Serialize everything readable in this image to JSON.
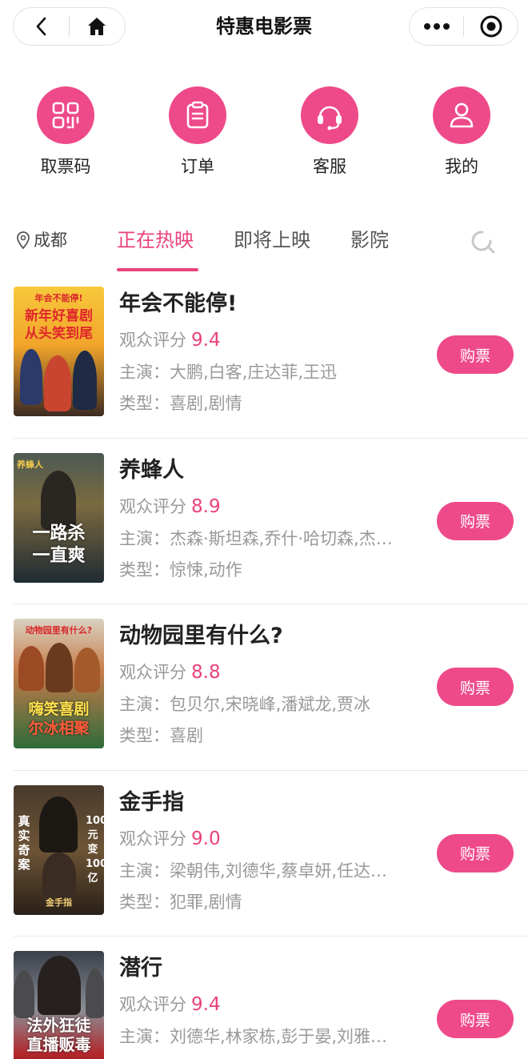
{
  "header": {
    "title": "特惠电影票"
  },
  "quick_menu": [
    {
      "label": "取票码",
      "icon": "ticket-code-icon"
    },
    {
      "label": "订单",
      "icon": "order-clipboard-icon"
    },
    {
      "label": "客服",
      "icon": "headset-icon"
    },
    {
      "label": "我的",
      "icon": "user-icon"
    }
  ],
  "tabs": {
    "city": "成都",
    "items": [
      "正在热映",
      "即将上映",
      "影院"
    ],
    "active_index": 0
  },
  "movies": [
    {
      "title": "年会不能停!",
      "rating_label": "观众评分",
      "rating": "9.4",
      "actors": "主演：大鹏,白客,庄达菲,王迅",
      "genre": "类型：喜剧,剧情",
      "buy_label": "购票",
      "poster_text": [
        "新年好喜剧",
        "从头笑到尾"
      ]
    },
    {
      "title": "养蜂人",
      "rating_label": "观众评分",
      "rating": "8.9",
      "actors": "主演：杰森·斯坦森,乔什·哈切森,杰…",
      "genre": "类型：惊悚,动作",
      "buy_label": "购票",
      "poster_text": [
        "一路杀",
        "一直爽"
      ]
    },
    {
      "title": "动物园里有什么?",
      "rating_label": "观众评分",
      "rating": "8.8",
      "actors": "主演：包贝尔,宋晓峰,潘斌龙,贾冰",
      "genre": "类型：喜剧",
      "buy_label": "购票",
      "poster_text": [
        "嗨笑喜剧",
        "尔冰相聚"
      ]
    },
    {
      "title": "金手指",
      "rating_label": "观众评分",
      "rating": "9.0",
      "actors": "主演：梁朝伟,刘德华,蔡卓妍,任达…",
      "genre": "类型：犯罪,剧情",
      "buy_label": "购票",
      "poster_text": [
        "真实奇案",
        "100元变100亿"
      ]
    },
    {
      "title": "潜行",
      "rating_label": "观众评分",
      "rating": "9.4",
      "actors": "主演：刘德华,林家栋,彭于晏,刘雅…",
      "genre": "",
      "buy_label": "购票",
      "poster_text": [
        "法外狂徒",
        "直播贩毒"
      ]
    }
  ],
  "colors": {
    "accent": "#ee4a8a",
    "active_tab": "#e9427e"
  }
}
